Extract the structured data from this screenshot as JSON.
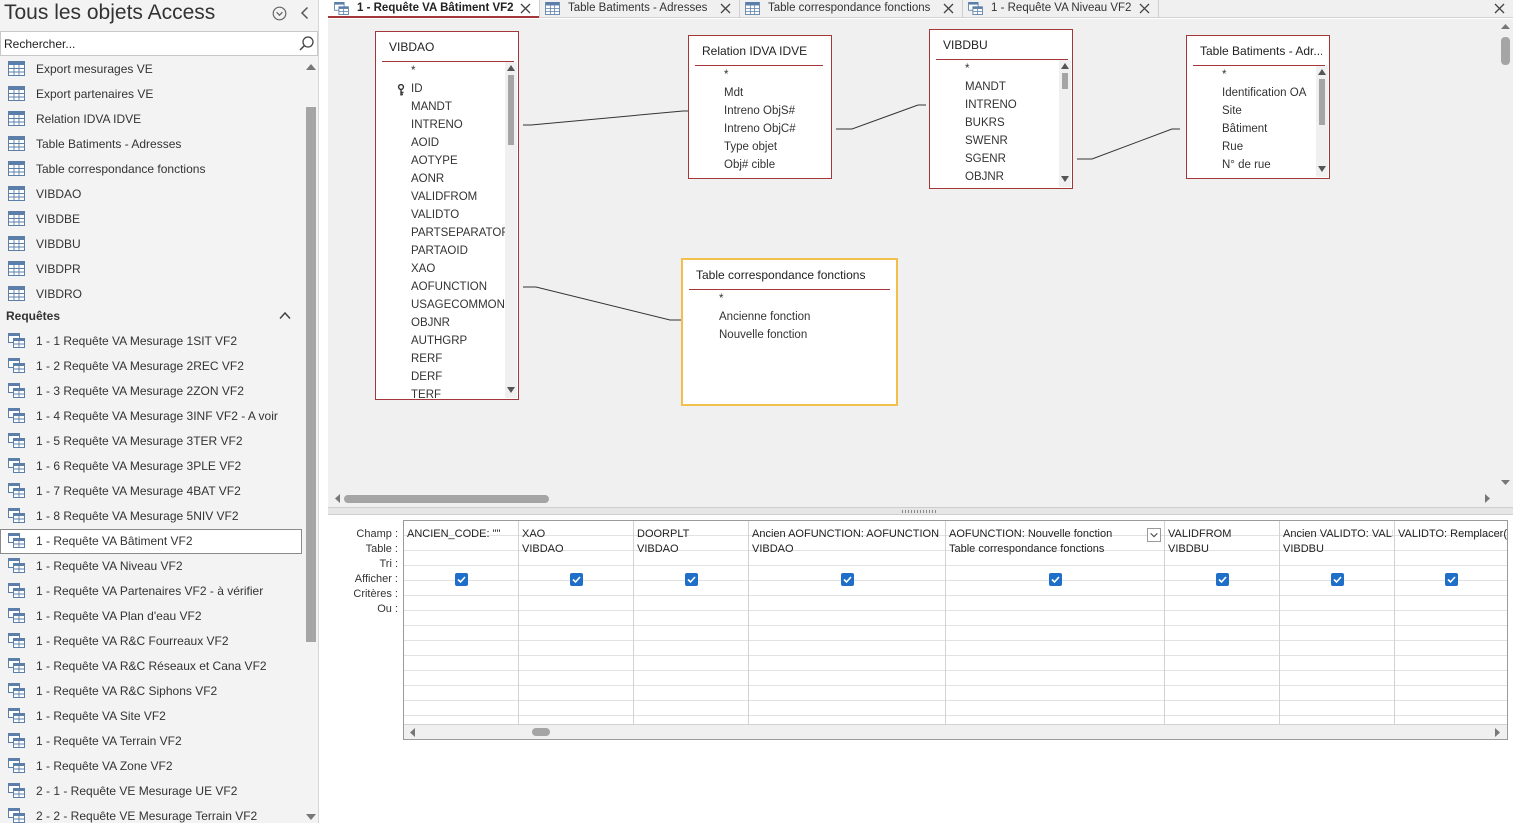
{
  "colors": {
    "accent": "#a4373a",
    "selected_table_border": "#f2c04a",
    "checkbox": "#1f6fc9",
    "design_background": "#f0f0f0",
    "nav_background": "#f3f3f3"
  },
  "nav": {
    "title": "Tous les objets Access",
    "menu_icon": "circle-chevron-down-icon",
    "collapse_icon": "chevron-left-icon",
    "search": {
      "placeholder": "Rechercher...",
      "value": ""
    },
    "tables": [
      {
        "label": "Export mesurages VE",
        "icon": "table-icon"
      },
      {
        "label": "Export partenaires VE",
        "icon": "table-icon"
      },
      {
        "label": "Relation IDVA IDVE",
        "icon": "table-icon"
      },
      {
        "label": "Table Batiments - Adresses",
        "icon": "table-icon"
      },
      {
        "label": "Table correspondance fonctions",
        "icon": "table-icon"
      },
      {
        "label": "VIBDAO",
        "icon": "table-icon"
      },
      {
        "label": "VIBDBE",
        "icon": "table-icon"
      },
      {
        "label": "VIBDBU",
        "icon": "table-icon"
      },
      {
        "label": "VIBDPR",
        "icon": "table-icon"
      },
      {
        "label": "VIBDRO",
        "icon": "table-icon"
      }
    ],
    "queries_group": {
      "label": "Requêtes",
      "icon": "chevron-up-icon"
    },
    "queries": [
      {
        "label": "1 - 1 Requête VA Mesurage 1SIT VF2",
        "selected": false
      },
      {
        "label": "1 - 2 Requête VA Mesurage 2REC VF2",
        "selected": false
      },
      {
        "label": "1 - 3 Requête VA Mesurage 2ZON VF2",
        "selected": false
      },
      {
        "label": "1 - 4 Requête VA Mesurage 3INF VF2 - A voir",
        "selected": false
      },
      {
        "label": "1 - 5 Requête VA Mesurage 3TER VF2",
        "selected": false
      },
      {
        "label": "1 - 6 Requête VA Mesurage 3PLE VF2",
        "selected": false
      },
      {
        "label": "1 - 7 Requête VA Mesurage 4BAT VF2",
        "selected": false
      },
      {
        "label": "1 - 8 Requête VA Mesurage 5NIV VF2",
        "selected": false
      },
      {
        "label": "1 - Requête VA Bâtiment VF2",
        "selected": true
      },
      {
        "label": "1 - Requête VA Niveau VF2",
        "selected": false
      },
      {
        "label": "1 - Requête VA Partenaires VF2 - à vérifier",
        "selected": false
      },
      {
        "label": "1 - Requête VA Plan d'eau VF2",
        "selected": false
      },
      {
        "label": "1 - Requête VA R&C Fourreaux VF2",
        "selected": false
      },
      {
        "label": "1 - Requête VA R&C Réseaux et Cana VF2",
        "selected": false
      },
      {
        "label": "1 - Requête VA R&C Siphons VF2",
        "selected": false
      },
      {
        "label": "1 - Requête VA Site VF2",
        "selected": false
      },
      {
        "label": "1 - Requête VA Terrain VF2",
        "selected": false
      },
      {
        "label": "1 - Requête VA Zone VF2",
        "selected": false
      },
      {
        "label": "2 - 1 - Requête VE Mesurage UE VF2",
        "selected": false
      },
      {
        "label": "2 - 2 - Requête VE Mesurage Terrain VF2",
        "selected": false
      }
    ]
  },
  "tabs": [
    {
      "label": "1 - Requête VA Bâtiment VF2",
      "icon": "query-icon",
      "active": true
    },
    {
      "label": "Table Batiments - Adresses",
      "icon": "table-icon",
      "active": false
    },
    {
      "label": "Table correspondance fonctions",
      "icon": "table-icon",
      "active": false
    },
    {
      "label": "1 - Requête VA Niveau VF2",
      "icon": "query-icon",
      "active": false
    }
  ],
  "design": {
    "tables": [
      {
        "id": "vibdao",
        "title": "VIBDAO",
        "key_field": "ID",
        "fields": [
          "*",
          "ID",
          "MANDT",
          "INTRENO",
          "AOID",
          "AOTYPE",
          "AONR",
          "VALIDFROM",
          "VALIDTO",
          "PARTSEPARATOR",
          "PARTAOID",
          "XAO",
          "AOFUNCTION",
          "USAGECOMMON",
          "OBJNR",
          "AUTHGRP",
          "RERF",
          "DERF",
          "TERF"
        ]
      },
      {
        "id": "relation",
        "title": "Relation IDVA IDVE",
        "fields": [
          "*",
          "Mdt",
          "Intreno ObjS#",
          "Intreno ObjC#",
          "Type objet",
          "Obj# cible"
        ]
      },
      {
        "id": "vibdbu",
        "title": "VIBDBU",
        "fields": [
          "*",
          "MANDT",
          "INTRENO",
          "BUKRS",
          "SWENR",
          "SGENR",
          "OBJNR"
        ]
      },
      {
        "id": "batiments",
        "title": "Table Batiments - Adr...",
        "fields": [
          "*",
          "Identification OA",
          "Site",
          "Bâtiment",
          "Rue",
          "N° de rue"
        ]
      },
      {
        "id": "correspondance",
        "title": "Table correspondance fonctions",
        "fields": [
          "*",
          "Ancienne fonction",
          "Nouvelle fonction"
        ]
      }
    ]
  },
  "grid": {
    "row_labels": {
      "field": "Champ :",
      "table": "Table :",
      "sort": "Tri :",
      "show": "Afficher :",
      "criteria": "Critères :",
      "or": "Ou :"
    },
    "columns": [
      {
        "field": "ANCIEN_CODE: \"\"",
        "table": "",
        "show": true
      },
      {
        "field": "XAO",
        "table": "VIBDAO",
        "show": true
      },
      {
        "field": "DOORPLT",
        "table": "VIBDAO",
        "show": true
      },
      {
        "field": "Ancien AOFUNCTION: AOFUNCTION",
        "table": "VIBDAO",
        "show": true
      },
      {
        "field": "AOFUNCTION: Nouvelle fonction",
        "table": "Table correspondance fonctions",
        "show": true,
        "has_dropdown": true
      },
      {
        "field": "VALIDFROM",
        "table": "VIBDBU",
        "show": true
      },
      {
        "field": "Ancien VALIDTO: VALIDTO",
        "table": "VIBDBU",
        "show": true
      },
      {
        "field": "VALIDTO: Remplacer(",
        "table": "",
        "show": true
      }
    ]
  }
}
